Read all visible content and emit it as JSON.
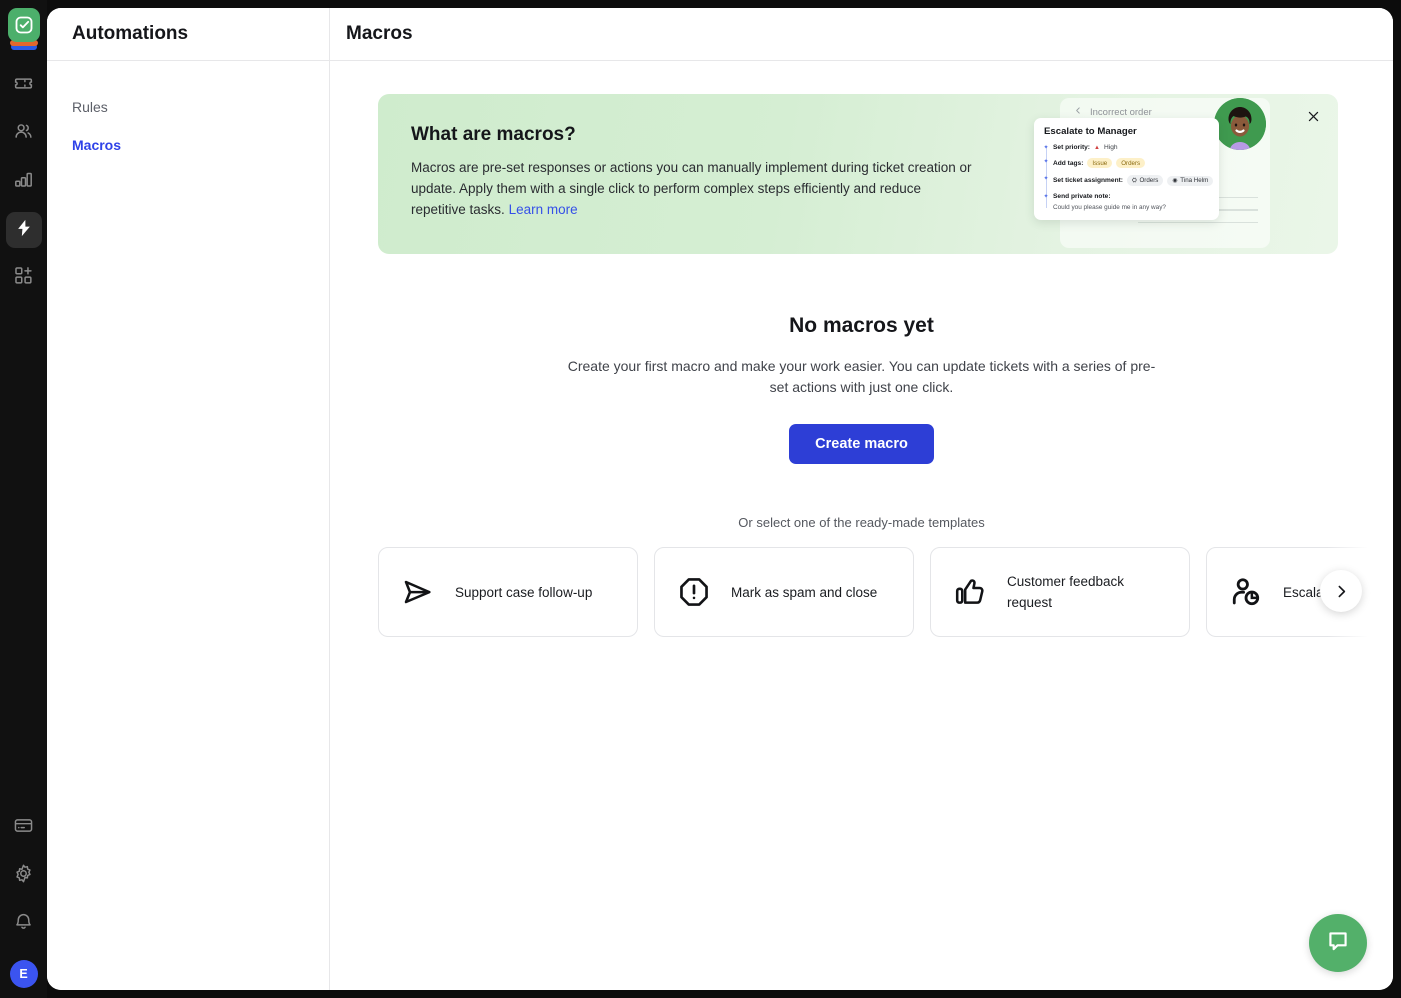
{
  "rail": {
    "logo": {
      "name": "workspace-logo",
      "color": "#4caf6b"
    },
    "items": [
      {
        "id": "tickets",
        "icon": "ticket-icon",
        "active": false
      },
      {
        "id": "contacts",
        "icon": "people-icon",
        "active": false
      },
      {
        "id": "reports",
        "icon": "bar-chart-icon",
        "active": false
      },
      {
        "id": "automations",
        "icon": "lightning-bolt-icon",
        "active": true
      },
      {
        "id": "apps",
        "icon": "apps-add-icon",
        "active": false
      }
    ],
    "bottom_items": [
      {
        "id": "billing",
        "icon": "credit-card-icon"
      },
      {
        "id": "settings",
        "icon": "gear-icon"
      },
      {
        "id": "notifications",
        "icon": "bell-icon"
      }
    ],
    "avatar_initial": "E",
    "avatar_color": "#3b54f0"
  },
  "nav": {
    "title": "Automations",
    "items": [
      {
        "label": "Rules",
        "active": false
      },
      {
        "label": "Macros",
        "active": true
      }
    ]
  },
  "main": {
    "title": "Macros"
  },
  "banner": {
    "title": "What are macros?",
    "body": "Macros are pre-set responses or actions you can manually implement during ticket creation or update. Apply them with a single click to perform complex steps efficiently and reduce repetitive tasks.",
    "link_label": "Learn more",
    "close_label": "✕",
    "illustration": {
      "back_ticket_title": "Incorrect order",
      "card_title": "Escalate to Manager",
      "rows": [
        {
          "label": "Set priority:",
          "value": "High",
          "value_type": "priority"
        },
        {
          "label": "Add tags:",
          "tags": [
            "Issue",
            "Orders"
          ]
        },
        {
          "label": "Set ticket assignment:",
          "assignees": [
            "Orders",
            "Tina Helm"
          ]
        },
        {
          "label": "Send private note:",
          "note": "Could you please guide me in any way?"
        }
      ]
    }
  },
  "empty_state": {
    "title": "No macros yet",
    "subtitle": "Create your first macro and make your work easier. You can update tickets with a series of pre-set actions with just one click.",
    "cta_label": "Create macro",
    "cta_color": "#2d3ed6"
  },
  "templates": {
    "caption": "Or select one of the ready-made templates",
    "cards": [
      {
        "label": "Support case follow-up",
        "icon": "paper-plane-icon"
      },
      {
        "label": "Mark as spam and close",
        "icon": "octagon-alert-icon"
      },
      {
        "label": "Customer feedback request",
        "icon": "thumbs-up-icon"
      },
      {
        "label": "Escalate to",
        "icon": "user-clock-icon"
      }
    ],
    "next_label": "›"
  },
  "chat": {
    "icon": "chat-bubble-icon",
    "color": "#53b06a"
  }
}
